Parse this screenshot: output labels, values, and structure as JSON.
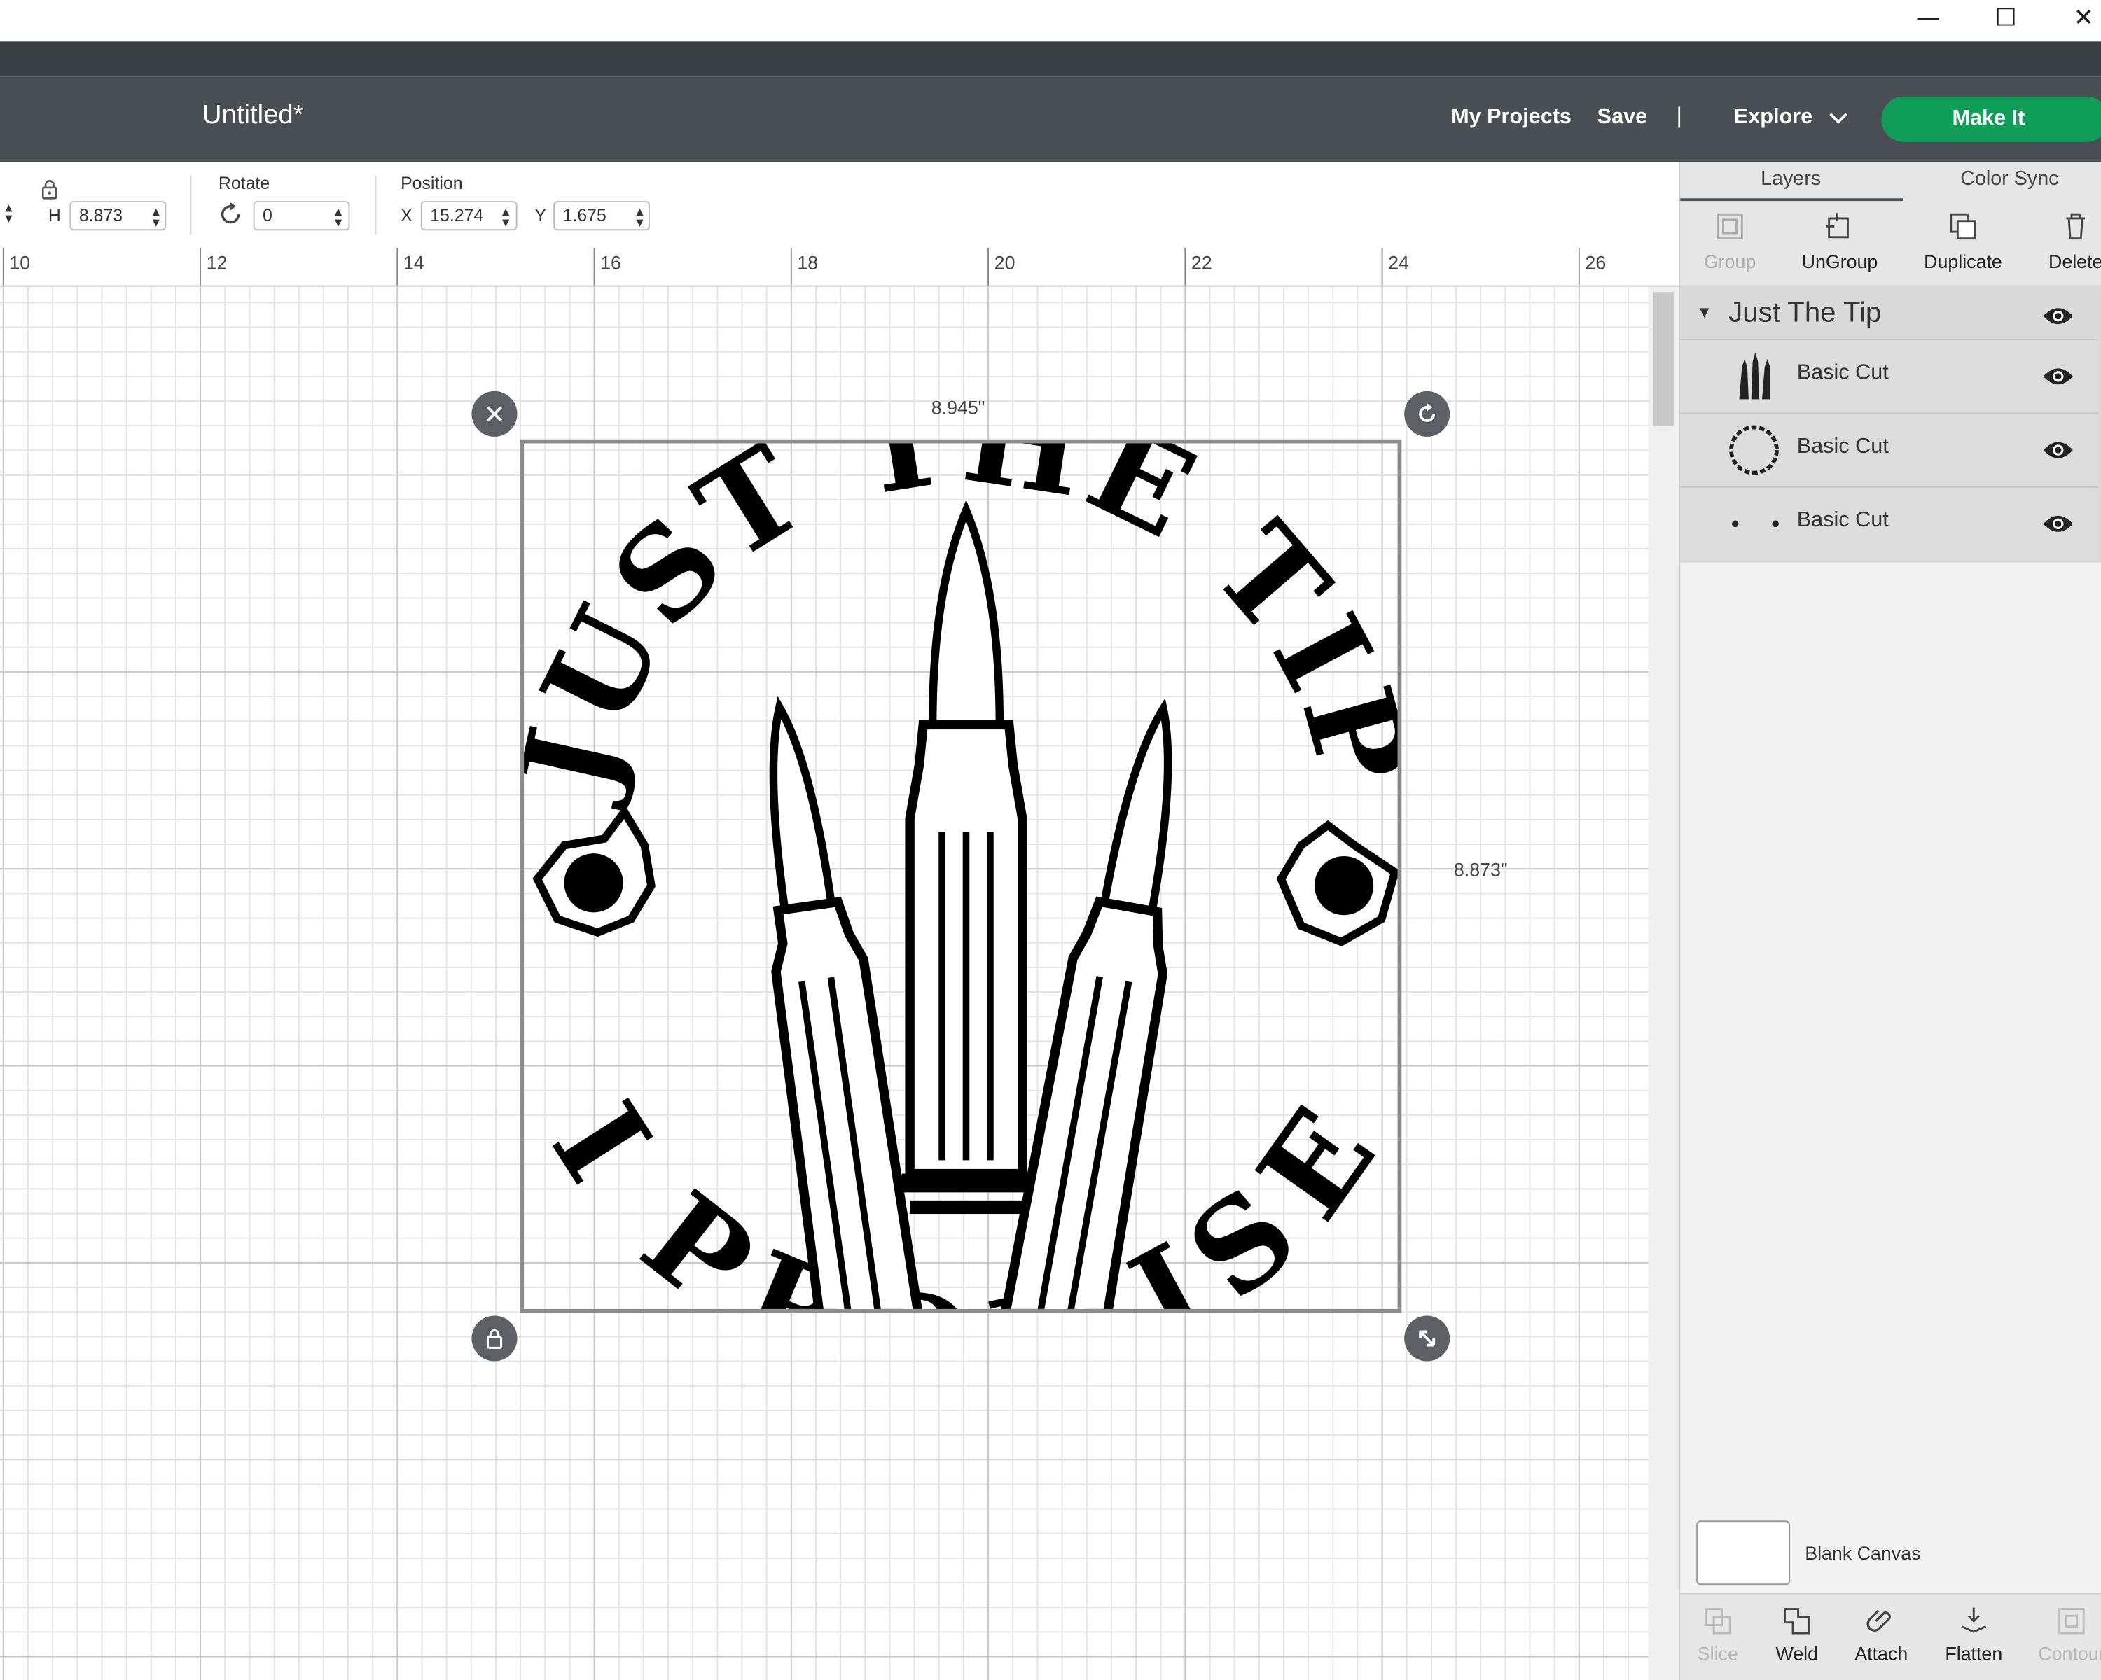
{
  "window": {
    "minimize": "—",
    "maximize": "☐",
    "close": "✕"
  },
  "header": {
    "title": "Untitled*",
    "my_projects": "My Projects",
    "save": "Save",
    "separator": "|",
    "explore": "Explore",
    "make_it": "Make It"
  },
  "toolbar": {
    "h_label": "H",
    "h_value": "8.873",
    "rotate_label": "Rotate",
    "rotate_value": "0",
    "position_label": "Position",
    "x_label": "X",
    "x_value": "15.274",
    "y_label": "Y",
    "y_value": "1.675"
  },
  "ruler": {
    "labels": [
      "10",
      "12",
      "14",
      "16",
      "18",
      "20",
      "22",
      "24",
      "26"
    ]
  },
  "canvas": {
    "width_label": "8.945\"",
    "height_label": "8.873\"",
    "art_text": {
      "top": "JUST THE TIP",
      "bottom": "I PROMISE"
    }
  },
  "panel": {
    "tabs": [
      "Layers",
      "Color Sync"
    ],
    "tools": [
      "Group",
      "UnGroup",
      "Duplicate",
      "Delete"
    ],
    "group_name": "Just The Tip",
    "layers": [
      "Basic Cut",
      "Basic Cut",
      "Basic Cut"
    ],
    "blank_canvas": "Blank Canvas",
    "bottom_tools": [
      "Slice",
      "Weld",
      "Attach",
      "Flatten",
      "Contour"
    ]
  },
  "colors": {
    "header": "#4a4f54",
    "make_it": "#0f9d58",
    "panel": "#f2f2f2"
  }
}
